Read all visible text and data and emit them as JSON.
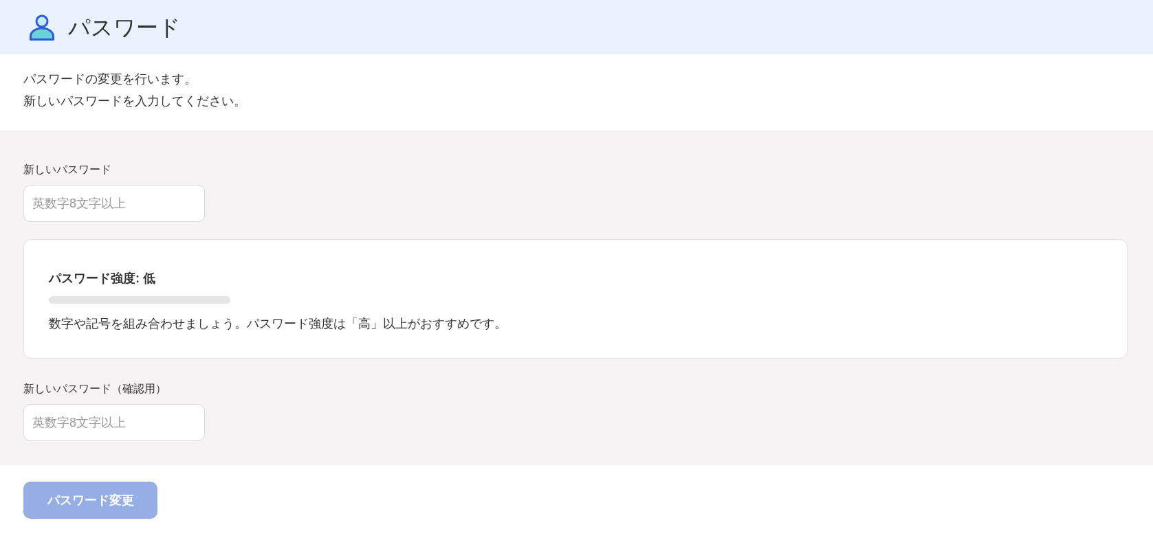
{
  "header": {
    "title": "パスワード"
  },
  "intro": {
    "lines": [
      "パスワードの変更を行います。",
      "新しいパスワードを入力してください。"
    ]
  },
  "new_password": {
    "label": "新しいパスワード",
    "placeholder": "英数字8文字以上"
  },
  "strength": {
    "title": "パスワード強度: 低",
    "level": 0,
    "hint": "数字や記号を組み合わせましょう。パスワード強度は「高」以上がおすすめです。"
  },
  "confirm_password": {
    "label": "新しいパスワード（確認用）",
    "placeholder": "英数字8文字以上"
  },
  "submit_button": {
    "label": "パスワード変更",
    "disabled": true
  }
}
